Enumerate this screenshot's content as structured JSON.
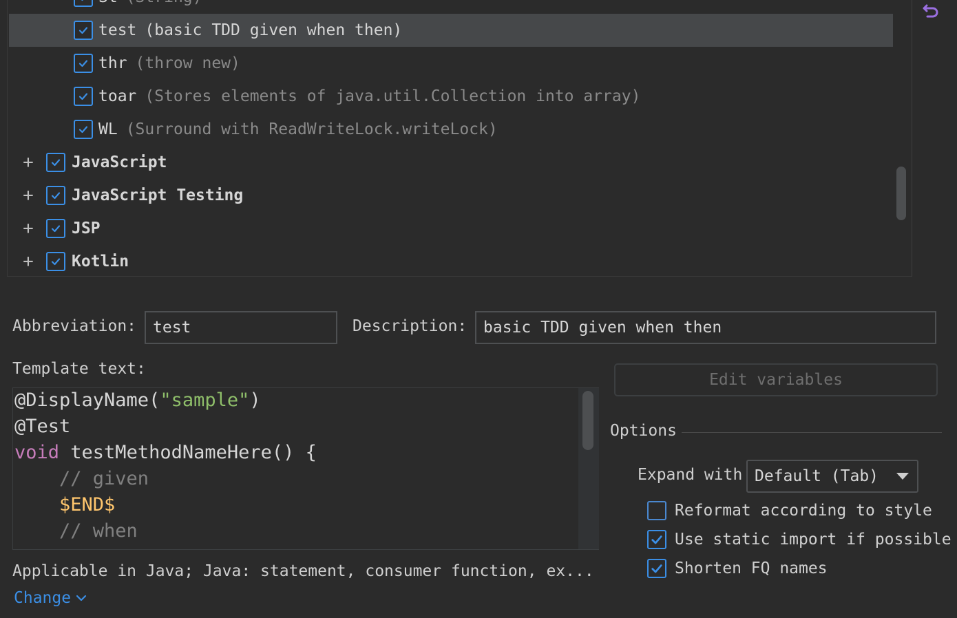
{
  "tree": {
    "items": [
      {
        "name": "St",
        "desc": "(String)",
        "checked": true,
        "kind": "item"
      },
      {
        "name": "test",
        "desc": "(basic TDD given when then)",
        "checked": true,
        "kind": "item",
        "selected": true
      },
      {
        "name": "thr",
        "desc": "(throw new)",
        "checked": true,
        "kind": "item"
      },
      {
        "name": "toar",
        "desc": "(Stores elements of java.util.Collection into array)",
        "checked": true,
        "kind": "item"
      },
      {
        "name": "WL",
        "desc": "(Surround with ReadWriteLock.writeLock)",
        "checked": true,
        "kind": "item"
      },
      {
        "name": "JavaScript",
        "checked": true,
        "kind": "group"
      },
      {
        "name": "JavaScript Testing",
        "checked": true,
        "kind": "group"
      },
      {
        "name": "JSP",
        "checked": true,
        "kind": "group"
      },
      {
        "name": "Kotlin",
        "checked": true,
        "kind": "group"
      }
    ],
    "expand_glyph": "+"
  },
  "form": {
    "abbreviation_label": "Abbreviation:",
    "abbreviation_value": "test",
    "description_label": "Description:",
    "description_value": "basic TDD given when then",
    "template_label": "Template text:",
    "edit_variables_label": "Edit variables",
    "options_label": "Options",
    "expand_with_label": "Expand with",
    "expand_with_value": "Default (Tab)",
    "options": [
      {
        "label": "Reformat according to style",
        "checked": false
      },
      {
        "label": "Use static import if possible",
        "checked": true
      },
      {
        "label": "Shorten FQ names",
        "checked": true
      }
    ],
    "applicable_text": "Applicable in Java; Java: statement, consumer function, ex...",
    "change_label": "Change"
  },
  "editor": {
    "lines": [
      [
        {
          "t": "@DisplayName(",
          "c": "c-plain"
        },
        {
          "t": "\"sample\"",
          "c": "c-str"
        },
        {
          "t": ")",
          "c": "c-plain"
        }
      ],
      [
        {
          "t": "@Test",
          "c": "c-plain"
        }
      ],
      [
        {
          "t": "void",
          "c": "c-kw-purple"
        },
        {
          "t": " testMethodNameHere() {",
          "c": "c-plain"
        }
      ],
      [
        {
          "t": "    // given",
          "c": "c-comment"
        }
      ],
      [
        {
          "t": "    $END$",
          "c": "c-var"
        }
      ],
      [
        {
          "t": "    // when",
          "c": "c-comment"
        }
      ]
    ]
  },
  "colors": {
    "accent": "#3b8fe6",
    "background": "#2b2b2b",
    "selection": "#46484a",
    "undo_icon": "#9a6fe0"
  },
  "icons": {
    "undo": "undo-icon",
    "check": "check-icon",
    "dropdown": "chevron-down-icon"
  }
}
